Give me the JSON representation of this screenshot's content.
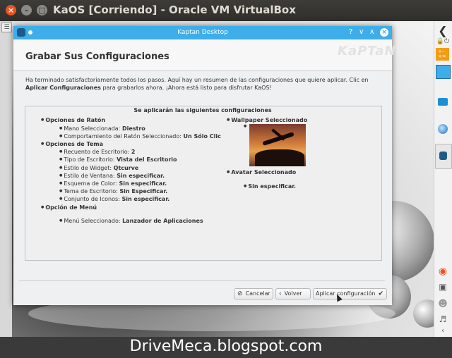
{
  "window": {
    "title": "KaOS [Corriendo] - Oracle VM VirtualBox",
    "close": "×",
    "minimize": "–",
    "maximize": "□"
  },
  "left_menu_icon": "menu-icon",
  "dialog": {
    "title": "Kaptan Desktop",
    "controls": {
      "help": "?",
      "minimize": "∨",
      "maximize": "∧",
      "close": "×"
    },
    "page_title": "Grabar Sus Configuraciones",
    "logo": "KaPTaN",
    "intro_plain_1": "Ha terminado satisfactoriamente todos los pasos. Aquí hay un resumen de las configuraciones que quiere aplicar. Clic en ",
    "intro_bold_1": "Aplicar Configuraciones",
    "intro_plain_2": " para grabarlos ahora. ¡Ahora está listo para disfrutar KaOS!",
    "summary": {
      "heading": "Se aplicarán las siguientes configuraciones",
      "mouse": {
        "label": "Opciones de Ratón",
        "hand_label": "Mano Seleccionada: ",
        "hand_value": "Diestro",
        "behavior_label": "Comportamiento del Ratón Seleccionado: ",
        "behavior_value": "Un Sólo Clic"
      },
      "theme": {
        "label": "Opciones de Tema",
        "desktops_label": "Recuento de Escritorio: ",
        "desktops_value": "2",
        "desktop_type_label": "Tipo de Escritorio: ",
        "desktop_type_value": "Vista del Escritorio",
        "widget_label": "Estilo de Widget: ",
        "widget_value": "Qtcurve",
        "window_label": "Estilo de Ventana: ",
        "window_value": "Sin especificar.",
        "color_label": "Esquema de Color: ",
        "color_value": "Sin especificar.",
        "desktop_theme_label": "Tema de Escritorio: ",
        "desktop_theme_value": "Sin Especificar.",
        "icons_label": "Conjunto de Iconos: ",
        "icons_value": "Sin especificar."
      },
      "menu": {
        "label": "Opción de Menú",
        "selected_label": "Menú Seleccionado: ",
        "selected_value": "Lanzador de Aplicaciones"
      },
      "wallpaper": {
        "label": "Wallpaper Seleccionado"
      },
      "avatar": {
        "label": "Avatar Seleccionado",
        "value": "Sin especificar."
      }
    },
    "buttons": {
      "cancel": "Cancelar",
      "back": "Volver",
      "apply": "Aplicar configuración"
    }
  },
  "kaos_panel_icons": [
    "kaos-logo-icon",
    "lock-icon",
    "power-icon",
    "calculator-icon",
    "color-swatch-icon",
    "folder-icon",
    "browser-icon",
    "kaptan-icon",
    "ghost-icon",
    "display-icon",
    "user-icon",
    "volume-icon",
    "chevron-left-icon",
    "clock-icon"
  ],
  "banner": {
    "text": "DriveMeca.blogspot.com"
  }
}
